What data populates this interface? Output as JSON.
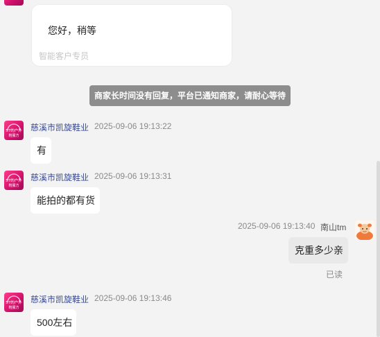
{
  "card": {
    "greeting": "您好，稍等",
    "agent_label": "智能客户专员"
  },
  "notice": "商家长时间没有回复，平台已通知商家，请耐心等待",
  "shop_avatar_text": [
    "57的户外",
    "鞋服方"
  ],
  "messages": [
    {
      "sender": "慈溪市凯旋鞋业",
      "time": "2025-09-06 19:13:22",
      "text": "有"
    },
    {
      "sender": "慈溪市凯旋鞋业",
      "time": "2025-09-06 19:13:31",
      "text": "能拍的都有货"
    },
    {
      "sender": "南山tm",
      "time": "2025-09-06 19:13:40",
      "text": "克重多少亲",
      "status": "已读"
    },
    {
      "sender": "慈溪市凯旋鞋业",
      "time": "2025-09-06 19:13:46",
      "text": "500左右"
    }
  ],
  "colors": {
    "background": "#f3f3f4",
    "bubble": "#ffffff",
    "own_bubble": "#e9e9ea",
    "sender_name": "#3b4b8f",
    "timestamp": "#8a8a8a",
    "notice_bg": "#8d8d8d",
    "shop_avatar": "#e0166f"
  },
  "icons": [
    "shop-avatar-icon",
    "user-avatar-icon"
  ]
}
